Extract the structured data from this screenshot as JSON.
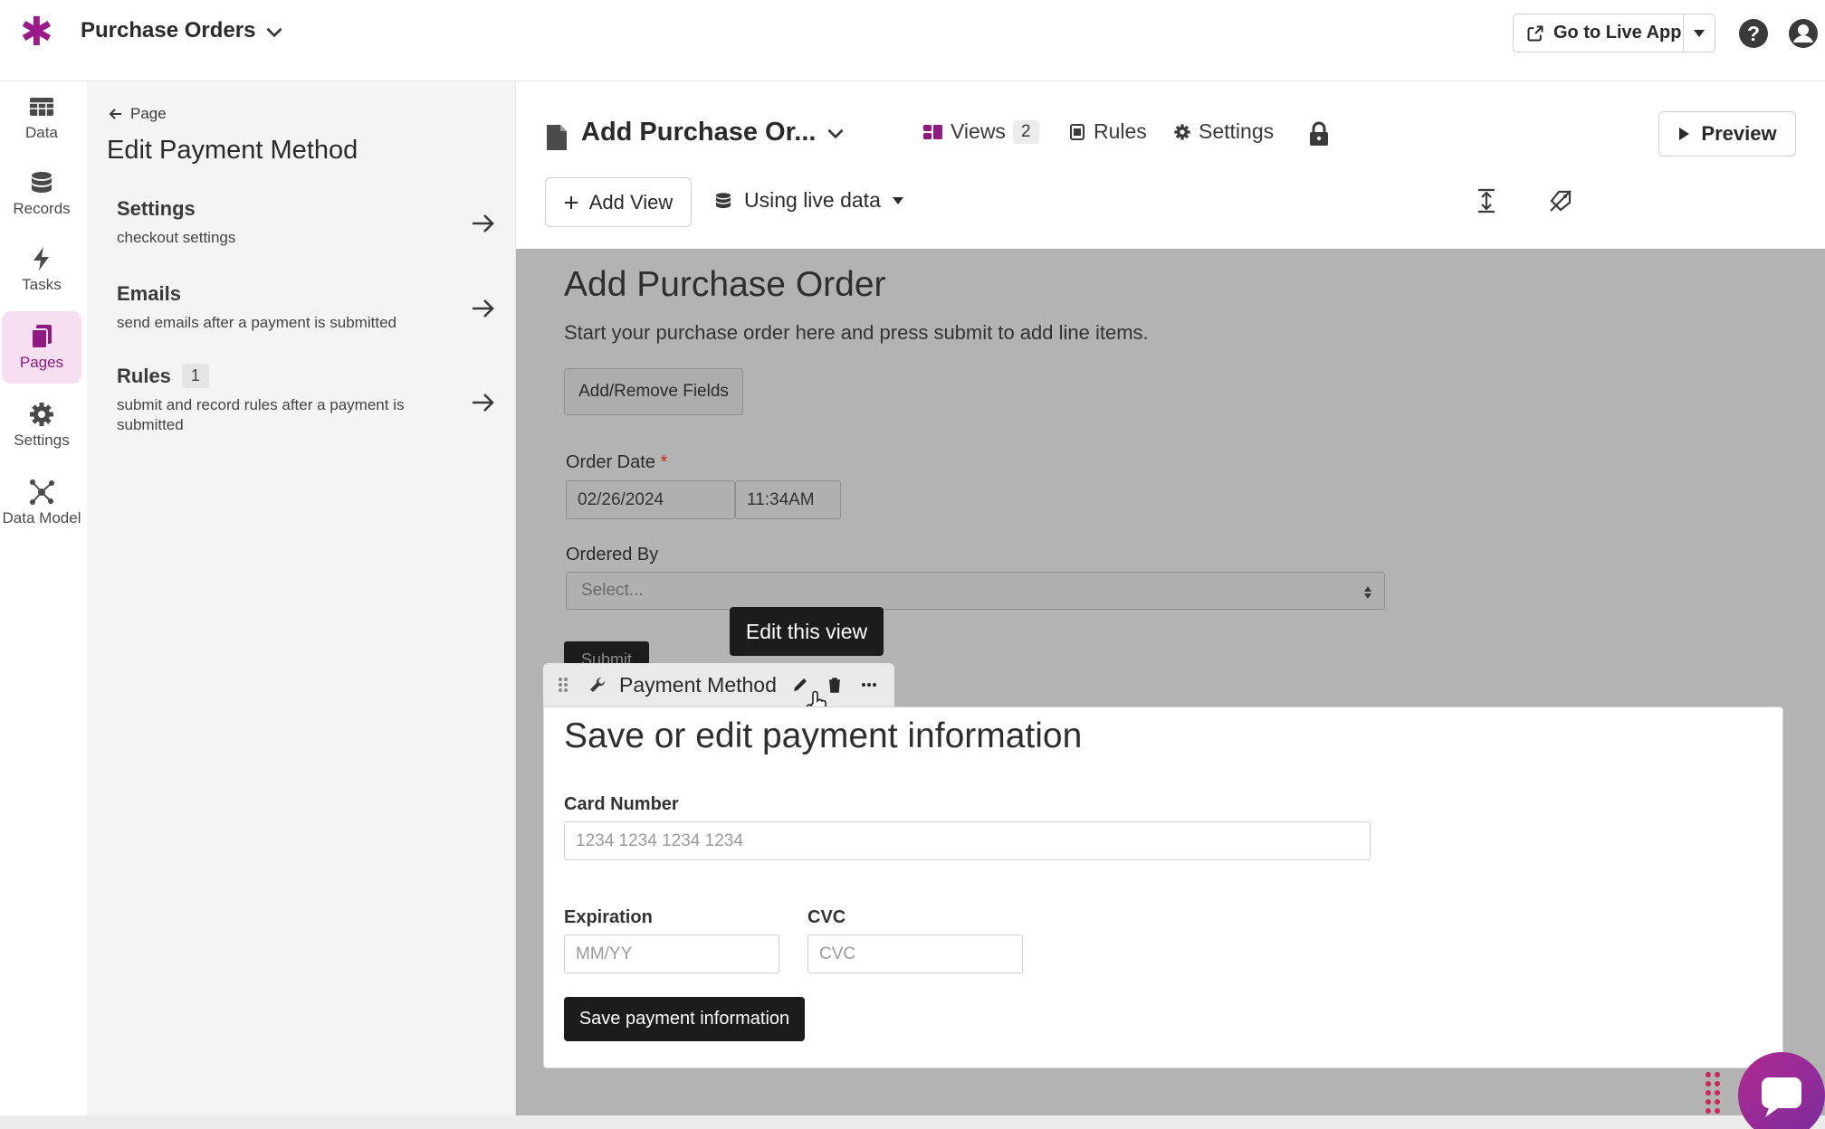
{
  "app": {
    "title": "Purchase Orders",
    "go_live_label": "Go to Live App",
    "accent_color": "#9b1a8a"
  },
  "nav": {
    "items": [
      {
        "label": "Data",
        "icon": "table-icon"
      },
      {
        "label": "Records",
        "icon": "database-icon"
      },
      {
        "label": "Tasks",
        "icon": "bolt-icon"
      },
      {
        "label": "Pages",
        "icon": "pages-icon",
        "active": true
      },
      {
        "label": "Settings",
        "icon": "gear-icon"
      },
      {
        "label": "Data Model",
        "icon": "data-model-icon"
      }
    ]
  },
  "panel": {
    "back_label": "Page",
    "title": "Edit Payment Method",
    "items": [
      {
        "title": "Settings",
        "desc": "checkout settings"
      },
      {
        "title": "Emails",
        "desc": "send emails after a payment is submitted"
      },
      {
        "title": "Rules",
        "badge": "1",
        "desc": "submit and record rules after a payment is submitted"
      }
    ]
  },
  "header": {
    "page_name": "Add Purchase Or...",
    "views_label": "Views",
    "views_count": "2",
    "rules_label": "Rules",
    "settings_label": "Settings",
    "preview_label": "Preview",
    "add_view_label": "Add View",
    "live_data_label": "Using live data"
  },
  "form": {
    "title": "Add Purchase Order",
    "subtitle": "Start your purchase order here and press submit to add line items.",
    "add_remove_label": "Add/Remove Fields",
    "order_date_label": "Order Date",
    "required_mark": "*",
    "order_date_value": "02/26/2024",
    "order_time_value": "11:34AM",
    "ordered_by_label": "Ordered By",
    "ordered_by_placeholder": "Select...",
    "submit_label": "Submit"
  },
  "tooltip": {
    "text": "Edit this view"
  },
  "view": {
    "name": "Payment Method",
    "card_title": "Save or edit payment information",
    "card_number_label": "Card Number",
    "card_number_placeholder": "1234 1234 1234 1234",
    "expiration_label": "Expiration",
    "expiration_placeholder": "MM/YY",
    "cvc_label": "CVC",
    "cvc_placeholder": "CVC",
    "save_label": "Save payment information"
  }
}
